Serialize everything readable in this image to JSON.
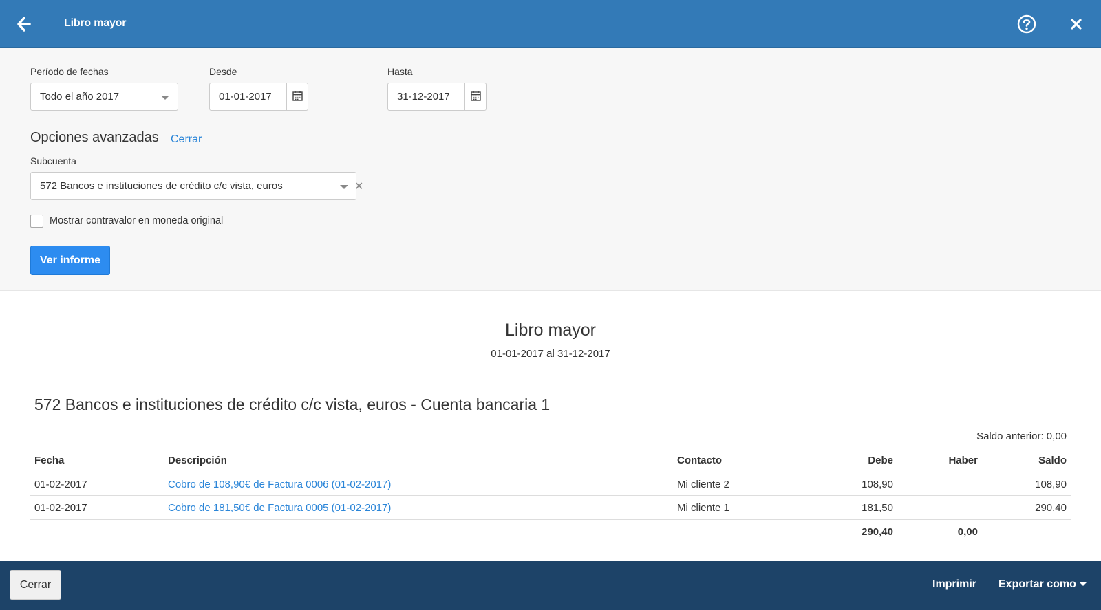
{
  "header": {
    "title": "Libro mayor",
    "back_icon": "arrow-left-icon",
    "help_icon": "question-circle-icon",
    "close_icon": "close-icon"
  },
  "filters": {
    "period_label": "Período de fechas",
    "period_value": "Todo el año 2017",
    "from_label": "Desde",
    "from_value": "01-01-2017",
    "to_label": "Hasta",
    "to_value": "31-12-2017",
    "advanced_title": "Opciones avanzadas",
    "advanced_close": "Cerrar",
    "subaccount_label": "Subcuenta",
    "subaccount_value": "572 Bancos e instituciones de crédito c/c vista, euros",
    "checkbox_label": "Mostrar contravalor en moneda original",
    "checkbox_checked": false,
    "submit_label": "Ver informe"
  },
  "report": {
    "title": "Libro mayor",
    "range": "01-01-2017 al 31-12-2017",
    "account_title": "572 Bancos e instituciones de crédito c/c vista, euros - Cuenta bancaria 1",
    "previous_balance": "Saldo anterior: 0,00",
    "columns": {
      "fecha": "Fecha",
      "descripcion": "Descripción",
      "contacto": "Contacto",
      "debe": "Debe",
      "haber": "Haber",
      "saldo": "Saldo"
    },
    "rows": [
      {
        "fecha": "01-02-2017",
        "descripcion": "Cobro de 108,90€ de Factura 0006 (01-02-2017)",
        "contacto": "Mi cliente 2",
        "debe": "108,90",
        "haber": "",
        "saldo": "108,90"
      },
      {
        "fecha": "01-02-2017",
        "descripcion": "Cobro de 181,50€ de Factura 0005 (01-02-2017)",
        "contacto": "Mi cliente 1",
        "debe": "181,50",
        "haber": "",
        "saldo": "290,40"
      }
    ],
    "totals": {
      "debe": "290,40",
      "haber": "0,00"
    }
  },
  "footer": {
    "close_label": "Cerrar",
    "print_label": "Imprimir",
    "export_label": "Exportar como"
  },
  "colors": {
    "header_bg": "#337ab7",
    "footer_bg": "#1d4368",
    "primary_button": "#2d8cf0",
    "link": "#2a85d8"
  }
}
